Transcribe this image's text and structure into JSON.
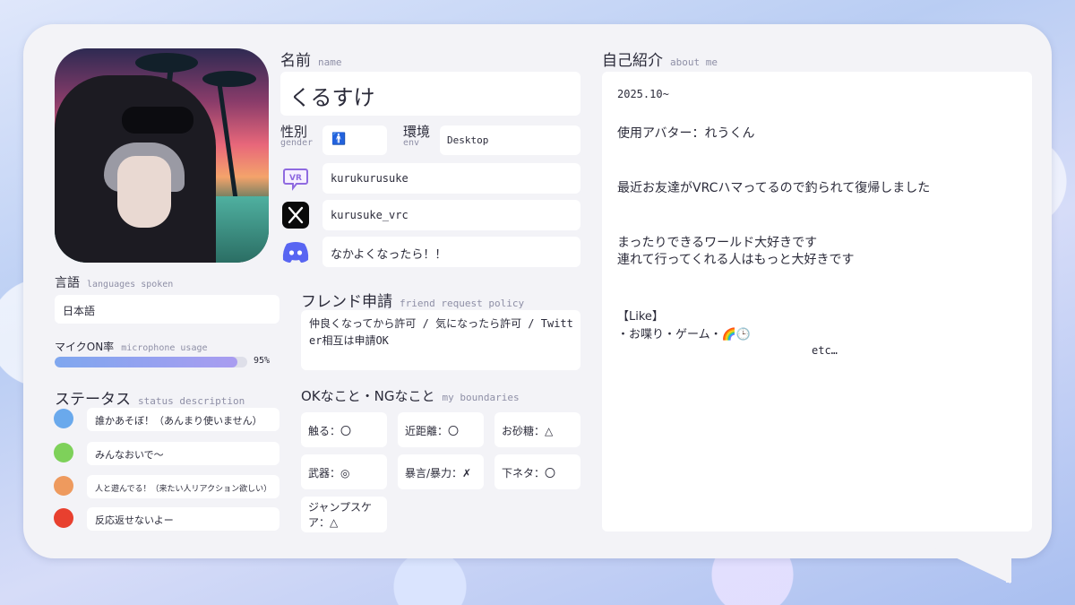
{
  "profile": {
    "name_label_jp": "名前",
    "name_label_en": "name",
    "name_value": "くるすけ",
    "gender_label_jp": "性別",
    "gender_label_en": "gender",
    "gender_symbol": "🚹",
    "env_label_jp": "環境",
    "env_label_en": "env",
    "env_value": "Desktop",
    "vrchat_id": "kurukurusuke",
    "twitter_id": "kurusuke_vrc",
    "discord_text": "なかよくなったら！！"
  },
  "icons": {
    "vrchat": "vrchat-icon",
    "x": "x-icon",
    "discord": "discord-icon",
    "vr_badge_text": "VR"
  },
  "languages": {
    "label_jp": "言語",
    "label_en": "languages spoken",
    "value": "日本語"
  },
  "mic": {
    "label_jp": "マイクON率",
    "label_en": "microphone usage",
    "percent_value": 95,
    "percent_text": "95%"
  },
  "status": {
    "label_jp": "ステータス",
    "label_en": "status description",
    "items": [
      {
        "color": "#6aa9ec",
        "text": "誰かあそぼ！（あんまり使いません）"
      },
      {
        "color": "#7ed15a",
        "text": "みんなおいで〜"
      },
      {
        "color": "#ee9a5e",
        "text": "人と遊んでる！（来たい人リアクション欲しい）"
      },
      {
        "color": "#e8402f",
        "text": "反応返せないよー"
      }
    ]
  },
  "friend": {
    "label_jp": "フレンド申請",
    "label_en": "friend request policy",
    "value": "仲良くなってから許可 / 気になったら許可 / Twitter相互は申請OK"
  },
  "boundaries": {
    "label_jp": "OKなこと・NGなこと",
    "label_en": "my boundaries",
    "items": [
      "触る：〇",
      "近距離：〇",
      "お砂糖：△",
      "武器：◎",
      "暴言/暴力：✗",
      "下ネタ：〇",
      "ジャンプスケア：△"
    ]
  },
  "about": {
    "label_jp": "自己紹介",
    "label_en": "about me",
    "lines": {
      "l1": "2025.10~",
      "l2": "使用アバター：れうくん",
      "l3": "最近お友達がVRCハマってるので釣られて復帰しました",
      "l4": "まったりできるワールド大好きです",
      "l5": "連れて行ってくれる人はもっと大好きです",
      "l6": "【Like】",
      "l7": "・お喋り・ゲーム・🌈🕒",
      "l8": "etc…"
    }
  }
}
